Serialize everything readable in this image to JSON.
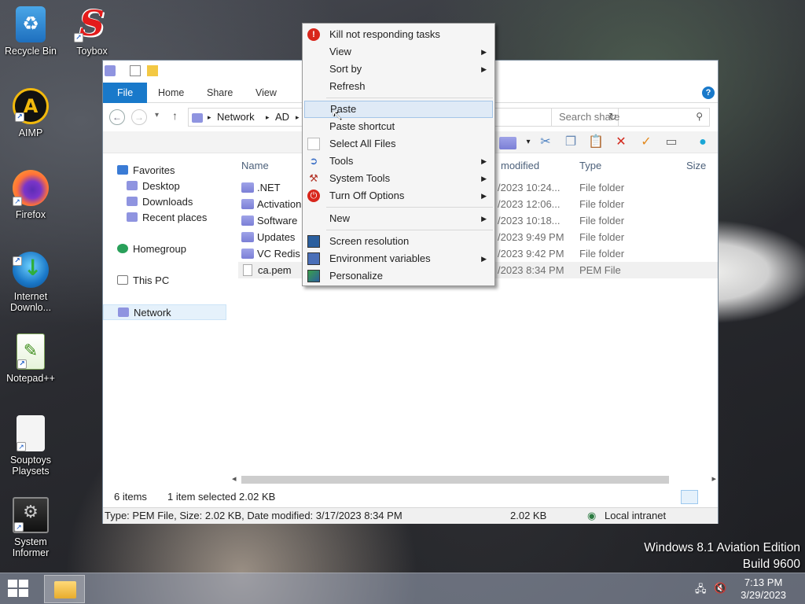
{
  "desktop": {
    "icons": [
      {
        "label": "Recycle Bin"
      },
      {
        "label": "Toybox"
      },
      {
        "label": "AIMP"
      },
      {
        "label": "Firefox"
      },
      {
        "label": "Internet Downlo..."
      },
      {
        "label": "Notepad++"
      },
      {
        "label": "Souptoys Playsets"
      },
      {
        "label": "System Informer"
      }
    ],
    "watermark_line1": "Windows 8.1 Aviation Edition",
    "watermark_line2": "Build 9600"
  },
  "explorer": {
    "tabs": [
      "File",
      "Home",
      "Share",
      "View"
    ],
    "help_label": "?",
    "close_label": "✕",
    "breadcrumb": [
      "Network",
      "AD"
    ],
    "search_placeholder": "Search share",
    "nav": {
      "favorites": "Favorites",
      "desktop": "Desktop",
      "downloads": "Downloads",
      "recent": "Recent places",
      "homegroup": "Homegroup",
      "thispc": "This PC",
      "network": "Network"
    },
    "columns": {
      "name": "Name",
      "modified": "modified",
      "type": "Type",
      "size": "Size"
    },
    "files": [
      {
        "name": ".NET",
        "date": "/2023 10:24...",
        "type": "File folder",
        "kind": "folder"
      },
      {
        "name": "Activation",
        "date": "/2023 12:06...",
        "type": "File folder",
        "kind": "folder"
      },
      {
        "name": "Software",
        "date": "/2023 10:18...",
        "type": "File folder",
        "kind": "folder"
      },
      {
        "name": "Updates",
        "date": "/2023 9:49 PM",
        "type": "File folder",
        "kind": "folder"
      },
      {
        "name": "VC Redis",
        "date": "/2023 9:42 PM",
        "type": "File folder",
        "kind": "folder"
      },
      {
        "name": "ca.pem",
        "date": "/2023 8:34 PM",
        "type": "PEM File",
        "kind": "file"
      }
    ],
    "status": {
      "items": "6 items",
      "selected": "1 item selected  2.02 KB"
    },
    "info": {
      "details": "Type: PEM File, Size: 2.02 KB, Date modified: 3/17/2023 8:34 PM",
      "size": "2.02 KB",
      "zone": "Local intranet"
    }
  },
  "context_menu": {
    "items": [
      {
        "label": "Kill not responding tasks",
        "icon": "stop-icon",
        "submenu": false
      },
      {
        "label": "View",
        "submenu": true
      },
      {
        "label": "Sort by",
        "submenu": true
      },
      {
        "label": "Refresh",
        "submenu": false
      },
      {
        "label": "Paste",
        "submenu": false,
        "highlighted": true
      },
      {
        "label": "Paste shortcut",
        "submenu": false
      },
      {
        "label": "Select All Files",
        "icon": "select-all-icon",
        "submenu": false
      },
      {
        "label": "Tools",
        "icon": "tools-icon",
        "submenu": true
      },
      {
        "label": "System Tools",
        "icon": "system-tools-icon",
        "submenu": true
      },
      {
        "label": "Turn Off Options",
        "icon": "power-icon",
        "submenu": true
      },
      {
        "label": "New",
        "submenu": true
      },
      {
        "label": "Screen resolution",
        "icon": "monitor-icon",
        "submenu": false
      },
      {
        "label": "Environment variables",
        "icon": "env-vars-icon",
        "submenu": true
      },
      {
        "label": "Personalize",
        "icon": "personalize-icon",
        "submenu": false
      }
    ]
  },
  "taskbar": {
    "time": "7:13 PM",
    "date": "3/29/2023"
  },
  "colors": {
    "accent": "#1979ca",
    "highlight": "#dfeaf6"
  }
}
